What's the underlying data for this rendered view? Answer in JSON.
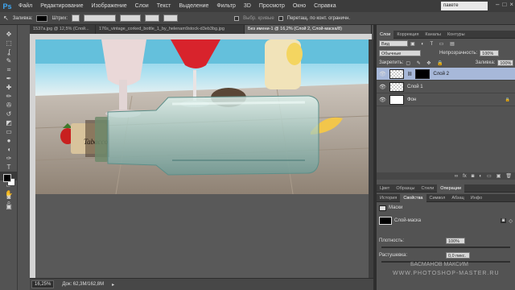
{
  "app": {
    "logo": "Ps",
    "menu": [
      "Файл",
      "Редактирование",
      "Изображение",
      "Слои",
      "Текст",
      "Выделение",
      "Фильтр",
      "3D",
      "Просмотр",
      "Окно",
      "Справка"
    ],
    "workspace": "пакeтe"
  },
  "options": {
    "mode_label": "Заливка:",
    "stroke_label": "Штрих:",
    "check1": "Выбр. кривые",
    "check2": "Перетащ. по конт. ограничн."
  },
  "tools": [
    "move-icon",
    "marquee-icon",
    "lasso-icon",
    "quick-select-icon",
    "crop-icon",
    "eyedropper-icon",
    "healing-icon",
    "brush-icon",
    "stamp-icon",
    "history-brush-icon",
    "eraser-icon",
    "gradient-icon",
    "blur-icon",
    "dodge-icon",
    "pen-icon",
    "type-icon",
    "path-select-icon",
    "shape-icon",
    "hand-icon",
    "zoom-icon"
  ],
  "tool_glyphs": [
    "✥",
    "⬚",
    "ʆ",
    "✎",
    "⌗",
    "✒",
    "✚",
    "✏",
    "✇",
    "↺",
    "◩",
    "▭",
    "●",
    "◖",
    "✑",
    "T",
    "↖",
    "▱",
    "✋",
    "⌕"
  ],
  "doc_tabs": [
    {
      "label": "1537a.jpg @ 12,5% (Слой..."
    },
    {
      "label": "176s_vintage_corked_bottle_1_by_helenam9stock-d3eb3bg.jpg"
    },
    {
      "label": "Без имени-1 @ 16,2% (Слой 2, Слой-маска/8)"
    }
  ],
  "status": {
    "zoom": "16,25%",
    "doc_size": "Док: 62,3M/162,8M"
  },
  "layers_panel": {
    "tabs": [
      "Слои",
      "Коррекция",
      "Каналы",
      "Контуры"
    ],
    "filter_label": "Вид",
    "blend_mode": "Обычные",
    "opacity_label": "Непрозрачность:",
    "opacity_value": "100%",
    "lock_label": "Закрепить:",
    "fill_label": "Заливка:",
    "fill_value": "100%",
    "layers": [
      {
        "name": "Слой 2",
        "selected": true
      },
      {
        "name": "Слой 1",
        "selected": false
      },
      {
        "name": "Фон",
        "selected": false
      }
    ]
  },
  "swatches_panel": {
    "tabs": [
      "Цвет",
      "Образцы",
      "Стили",
      "Операции"
    ]
  },
  "properties_panel": {
    "tabs": [
      "История",
      "Свойства",
      "Символ",
      "Абзац",
      "Инфо"
    ],
    "section_title": "Маски",
    "mask_label": "Слой-маска",
    "density_label": "Плотность:",
    "density_value": "100%",
    "feather_label": "Растушевка:",
    "feather_value": "0,0 пикс."
  },
  "watermark": {
    "line1": "БАСМАНОВ МАКСИМ",
    "line2": "WWW.PHOTOSHOP-MASTER.RU"
  },
  "colors": {
    "accent": "#3fa9f5",
    "selected_layer": "#a7b8d9",
    "ui_dark": "#3c3c3c"
  }
}
